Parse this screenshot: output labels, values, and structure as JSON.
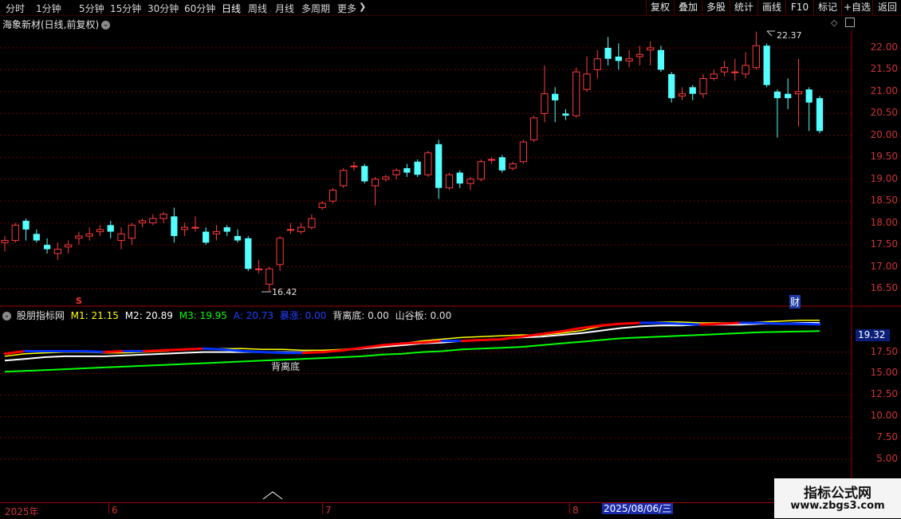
{
  "toolbar": {
    "periods": [
      "分时",
      "1分钟",
      "5分钟",
      "15分钟",
      "30分钟",
      "60分钟",
      "日线",
      "周线",
      "月线",
      "多周期",
      "更多"
    ],
    "active_period": "日线",
    "right_buttons": [
      "复权",
      "叠加",
      "多股",
      "统计",
      "画线",
      "F10",
      "标记",
      "+自选",
      "返回"
    ]
  },
  "main_chart": {
    "title": "海象新材(日线,前复权)",
    "y_labels": [
      "22.00",
      "21.50",
      "21.00",
      "20.50",
      "20.00",
      "19.50",
      "19.00",
      "18.50",
      "18.00",
      "17.50",
      "17.00",
      "16.50"
    ],
    "high_marker": "22.37",
    "low_marker": "16.42",
    "s_marker": "S",
    "fin_marker": "财"
  },
  "indicator": {
    "name": "股朋指标网",
    "m1_label": "M1: 21.15",
    "m2_label": "M2: 20.89",
    "m3_label": "M3: 19.95",
    "a_label": "A: 20.73",
    "surge_label": "暴涨: 0.00",
    "divergence_label": "背离底: 0.00",
    "valley_label": "山谷板: 0.00",
    "divergence_annotation": "背离底",
    "y_labels": [
      "17.50",
      "15.00",
      "12.50",
      "10.00",
      "7.50",
      "5.00"
    ],
    "current_value": "19.32",
    "colors": {
      "m1": "#ffff00",
      "m2": "#ffffff",
      "m3": "#00ff00",
      "a": "#0033ff",
      "hot": "#ff0000"
    }
  },
  "time_axis": {
    "labels": [
      "2025年",
      "6",
      "7",
      "8"
    ],
    "cursor_date": "2025/08/06/三"
  },
  "watermark": {
    "title": "指标公式网",
    "url": "www.zbgs3.com"
  },
  "chart_data": {
    "type": "candlestick",
    "ylim": [
      16.25,
      22.45
    ],
    "candles": [
      {
        "o": 17.55,
        "c": 17.6,
        "h": 17.7,
        "l": 17.35
      },
      {
        "o": 17.6,
        "c": 17.95,
        "h": 18.0,
        "l": 17.55
      },
      {
        "o": 18.05,
        "c": 17.85,
        "h": 18.1,
        "l": 17.6
      },
      {
        "o": 17.75,
        "c": 17.6,
        "h": 17.85,
        "l": 17.55
      },
      {
        "o": 17.5,
        "c": 17.4,
        "h": 17.65,
        "l": 17.3
      },
      {
        "o": 17.3,
        "c": 17.4,
        "h": 17.55,
        "l": 17.15
      },
      {
        "o": 17.45,
        "c": 17.5,
        "h": 17.6,
        "l": 17.3
      },
      {
        "o": 17.65,
        "c": 17.7,
        "h": 17.8,
        "l": 17.5
      },
      {
        "o": 17.7,
        "c": 17.75,
        "h": 17.9,
        "l": 17.6
      },
      {
        "o": 17.8,
        "c": 17.85,
        "h": 17.95,
        "l": 17.7
      },
      {
        "o": 17.95,
        "c": 17.8,
        "h": 18.05,
        "l": 17.65
      },
      {
        "o": 17.6,
        "c": 17.75,
        "h": 17.9,
        "l": 17.4
      },
      {
        "o": 17.65,
        "c": 17.95,
        "h": 18.0,
        "l": 17.5
      },
      {
        "o": 18.0,
        "c": 18.05,
        "h": 18.1,
        "l": 17.9
      },
      {
        "o": 18.0,
        "c": 18.1,
        "h": 18.2,
        "l": 17.95
      },
      {
        "o": 18.1,
        "c": 18.2,
        "h": 18.25,
        "l": 18.0
      },
      {
        "o": 18.15,
        "c": 17.7,
        "h": 18.35,
        "l": 17.55
      },
      {
        "o": 17.85,
        "c": 17.9,
        "h": 18.0,
        "l": 17.7
      },
      {
        "o": 17.9,
        "c": 17.9,
        "h": 18.15,
        "l": 17.8
      },
      {
        "o": 17.8,
        "c": 17.55,
        "h": 17.9,
        "l": 17.5
      },
      {
        "o": 17.75,
        "c": 17.8,
        "h": 17.95,
        "l": 17.6
      },
      {
        "o": 17.9,
        "c": 17.8,
        "h": 17.95,
        "l": 17.7
      },
      {
        "o": 17.7,
        "c": 17.6,
        "h": 17.85,
        "l": 17.55
      },
      {
        "o": 17.65,
        "c": 16.95,
        "h": 17.7,
        "l": 16.9
      },
      {
        "o": 16.95,
        "c": 16.95,
        "h": 17.15,
        "l": 16.85
      },
      {
        "o": 16.6,
        "c": 16.95,
        "h": 17.0,
        "l": 16.42
      },
      {
        "o": 17.05,
        "c": 17.65,
        "h": 17.7,
        "l": 16.9
      },
      {
        "o": 17.85,
        "c": 17.85,
        "h": 18.0,
        "l": 17.75
      },
      {
        "o": 17.8,
        "c": 17.9,
        "h": 18.0,
        "l": 17.75
      },
      {
        "o": 17.9,
        "c": 18.1,
        "h": 18.2,
        "l": 17.85
      },
      {
        "o": 18.35,
        "c": 18.45,
        "h": 18.5,
        "l": 18.3
      },
      {
        "o": 18.5,
        "c": 18.75,
        "h": 18.8,
        "l": 18.45
      },
      {
        "o": 18.85,
        "c": 19.2,
        "h": 19.25,
        "l": 18.8
      },
      {
        "o": 19.3,
        "c": 19.3,
        "h": 19.4,
        "l": 19.2
      },
      {
        "o": 19.3,
        "c": 18.95,
        "h": 19.35,
        "l": 18.9
      },
      {
        "o": 18.85,
        "c": 19.0,
        "h": 19.05,
        "l": 18.4
      },
      {
        "o": 19.0,
        "c": 19.05,
        "h": 19.1,
        "l": 18.95
      },
      {
        "o": 19.1,
        "c": 19.2,
        "h": 19.25,
        "l": 19.0
      },
      {
        "o": 19.25,
        "c": 19.15,
        "h": 19.35,
        "l": 19.05
      },
      {
        "o": 19.4,
        "c": 19.1,
        "h": 19.45,
        "l": 19.05
      },
      {
        "o": 19.1,
        "c": 19.6,
        "h": 19.65,
        "l": 19.05
      },
      {
        "o": 19.8,
        "c": 18.8,
        "h": 19.9,
        "l": 18.55
      },
      {
        "o": 18.8,
        "c": 19.1,
        "h": 19.15,
        "l": 18.75
      },
      {
        "o": 19.15,
        "c": 18.9,
        "h": 19.2,
        "l": 18.8
      },
      {
        "o": 18.9,
        "c": 19.0,
        "h": 19.05,
        "l": 18.75
      },
      {
        "o": 19.0,
        "c": 19.4,
        "h": 19.45,
        "l": 18.95
      },
      {
        "o": 19.45,
        "c": 19.45,
        "h": 19.5,
        "l": 19.35
      },
      {
        "o": 19.5,
        "c": 19.2,
        "h": 19.55,
        "l": 19.15
      },
      {
        "o": 19.25,
        "c": 19.35,
        "h": 19.4,
        "l": 19.2
      },
      {
        "o": 19.4,
        "c": 19.85,
        "h": 19.9,
        "l": 19.35
      },
      {
        "o": 19.9,
        "c": 20.4,
        "h": 20.45,
        "l": 19.85
      },
      {
        "o": 20.5,
        "c": 20.95,
        "h": 21.6,
        "l": 20.3
      },
      {
        "o": 20.95,
        "c": 20.8,
        "h": 21.1,
        "l": 20.3
      },
      {
        "o": 20.5,
        "c": 20.45,
        "h": 20.6,
        "l": 20.35
      },
      {
        "o": 20.45,
        "c": 21.45,
        "h": 21.55,
        "l": 20.4
      },
      {
        "o": 21.05,
        "c": 21.4,
        "h": 21.8,
        "l": 21.0
      },
      {
        "o": 21.5,
        "c": 21.75,
        "h": 21.95,
        "l": 21.3
      },
      {
        "o": 22.0,
        "c": 21.75,
        "h": 22.25,
        "l": 21.6
      },
      {
        "o": 21.8,
        "c": 21.7,
        "h": 22.1,
        "l": 21.5
      },
      {
        "o": 21.7,
        "c": 21.75,
        "h": 21.95,
        "l": 21.55
      },
      {
        "o": 21.8,
        "c": 21.85,
        "h": 22.05,
        "l": 21.6
      },
      {
        "o": 21.95,
        "c": 22.0,
        "h": 22.15,
        "l": 21.6
      },
      {
        "o": 21.95,
        "c": 21.5,
        "h": 22.05,
        "l": 21.45
      },
      {
        "o": 21.4,
        "c": 20.85,
        "h": 21.45,
        "l": 20.75
      },
      {
        "o": 20.9,
        "c": 20.95,
        "h": 21.1,
        "l": 20.8
      },
      {
        "o": 21.1,
        "c": 20.95,
        "h": 21.15,
        "l": 20.8
      },
      {
        "o": 20.95,
        "c": 21.3,
        "h": 21.4,
        "l": 20.85
      },
      {
        "o": 21.3,
        "c": 21.4,
        "h": 21.5,
        "l": 21.25
      },
      {
        "o": 21.45,
        "c": 21.55,
        "h": 21.7,
        "l": 21.35
      },
      {
        "o": 21.45,
        "c": 21.45,
        "h": 21.75,
        "l": 21.25
      },
      {
        "o": 21.4,
        "c": 21.6,
        "h": 21.9,
        "l": 21.3
      },
      {
        "o": 21.55,
        "c": 22.05,
        "h": 22.37,
        "l": 21.5
      },
      {
        "o": 22.05,
        "c": 21.15,
        "h": 22.1,
        "l": 21.1
      },
      {
        "o": 21.0,
        "c": 20.85,
        "h": 21.05,
        "l": 19.95
      },
      {
        "o": 20.95,
        "c": 20.85,
        "h": 21.3,
        "l": 20.6
      },
      {
        "o": 20.95,
        "c": 21.0,
        "h": 21.75,
        "l": 20.2
      },
      {
        "o": 21.05,
        "c": 20.75,
        "h": 21.1,
        "l": 20.1
      },
      {
        "o": 20.85,
        "c": 20.1,
        "h": 20.9,
        "l": 20.05
      }
    ],
    "indicator_lines": {
      "ylim": [
        2.5,
        21.5
      ],
      "m1": [
        17.0,
        17.3,
        17.4,
        17.5,
        17.5,
        17.4,
        17.4,
        17.5,
        17.6,
        17.8,
        17.9,
        17.9,
        17.9,
        17.8,
        17.8,
        17.7,
        17.7,
        17.8,
        18.0,
        18.2,
        18.5,
        18.8,
        19.0,
        19.2,
        19.3,
        19.4,
        19.5,
        19.5,
        19.7,
        20.0,
        20.5,
        20.8,
        20.9,
        21.0,
        21.0,
        20.9,
        20.9,
        20.9,
        21.0,
        21.1,
        21.2,
        21.2
      ],
      "m2": [
        16.5,
        16.7,
        16.9,
        17.0,
        17.0,
        17.0,
        17.1,
        17.2,
        17.3,
        17.4,
        17.5,
        17.5,
        17.5,
        17.5,
        17.5,
        17.5,
        17.5,
        17.7,
        17.9,
        18.1,
        18.3,
        18.5,
        18.6,
        18.8,
        18.9,
        19.0,
        19.2,
        19.3,
        19.5,
        19.7,
        20.0,
        20.3,
        20.5,
        20.6,
        20.6,
        20.7,
        20.7,
        20.7,
        20.8,
        20.8,
        20.9,
        20.9
      ],
      "m3": [
        15.2,
        15.3,
        15.4,
        15.5,
        15.6,
        15.7,
        15.8,
        15.9,
        16.0,
        16.1,
        16.2,
        16.3,
        16.4,
        16.5,
        16.6,
        16.7,
        16.8,
        16.9,
        17.0,
        17.2,
        17.3,
        17.5,
        17.6,
        17.8,
        17.9,
        18.0,
        18.1,
        18.3,
        18.5,
        18.7,
        18.9,
        19.1,
        19.2,
        19.3,
        19.4,
        19.5,
        19.6,
        19.7,
        19.8,
        19.85,
        19.9,
        19.95
      ],
      "a": [
        17.3,
        17.6,
        17.6,
        17.6,
        17.6,
        17.5,
        17.6,
        17.6,
        17.7,
        17.8,
        17.9,
        17.8,
        17.6,
        17.5,
        17.4,
        17.4,
        17.5,
        17.7,
        18.0,
        18.3,
        18.5,
        18.6,
        18.8,
        18.8,
        18.9,
        19.0,
        19.3,
        19.6,
        19.9,
        20.3,
        20.6,
        20.8,
        20.9,
        20.9,
        20.8,
        20.7,
        20.8,
        20.9,
        20.9,
        20.8,
        20.8,
        20.73
      ]
    }
  }
}
